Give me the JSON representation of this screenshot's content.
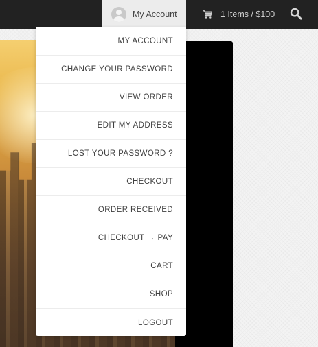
{
  "header": {
    "account_label": "My Account",
    "cart_label": "1 Items / $100",
    "icons": {
      "avatar": "user-avatar",
      "cart": "cart-icon",
      "search": "search-icon"
    }
  },
  "account_menu": {
    "items": [
      "MY ACCOUNT",
      "CHANGE YOUR PASSWORD",
      "VIEW ORDER",
      "EDIT MY ADDRESS",
      "LOST YOUR PASSWORD ?",
      "CHECKOUT",
      "ORDER RECEIVED",
      "CHECKOUT → PAY",
      "CART",
      "SHOP",
      "LOGOUT"
    ]
  },
  "colors": {
    "topbar": "#222222",
    "account_toggle_bg": "#ececec",
    "menu_text": "#404040",
    "header_text_light": "#cfcfcf"
  }
}
